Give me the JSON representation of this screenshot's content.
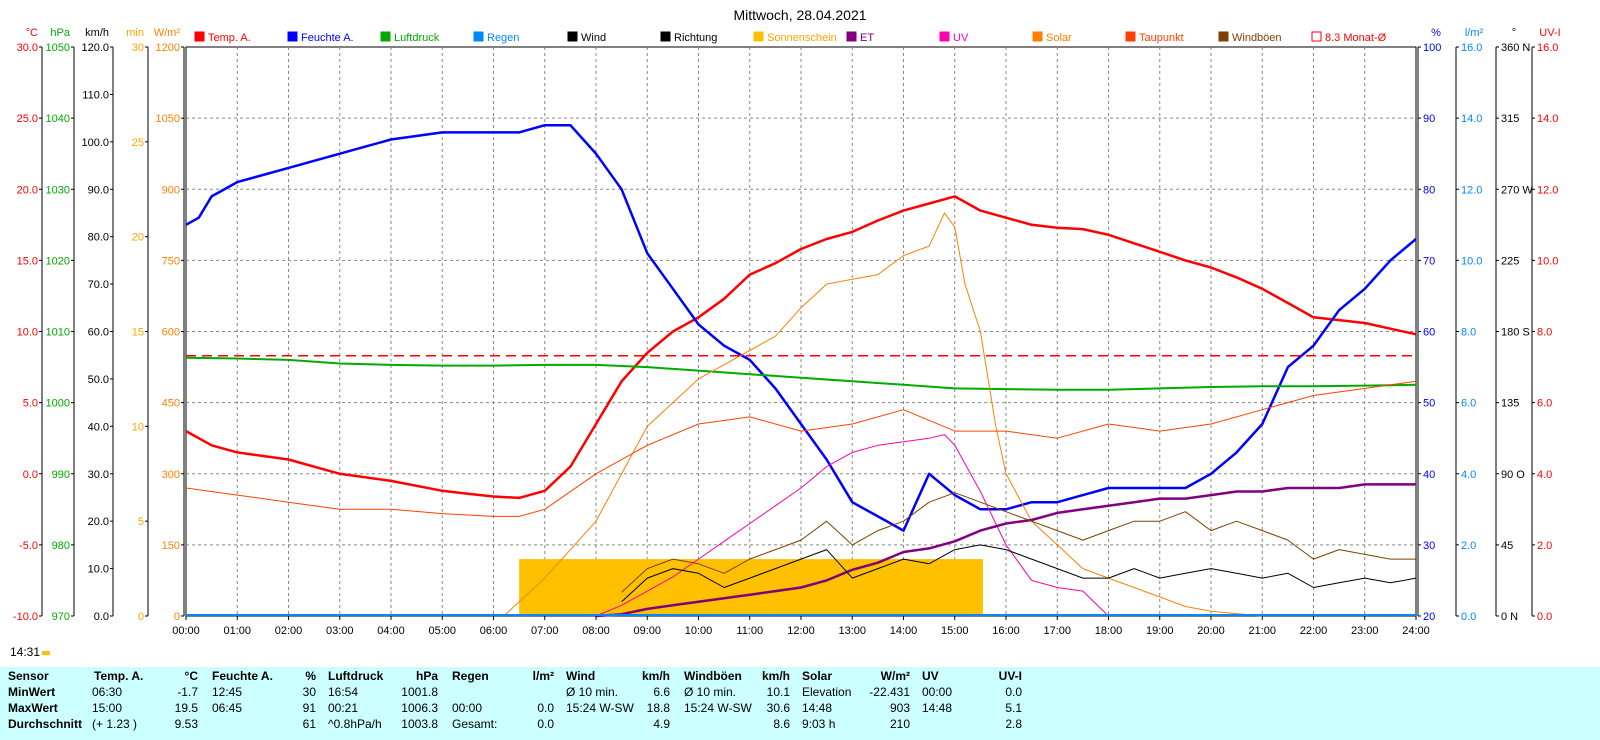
{
  "title": "Mittwoch, 28.04.2021",
  "timestamp": "14:31",
  "colors": {
    "temp": "#ff0000",
    "humidity": "#0000ff",
    "pressure": "#00aa00",
    "rain": "#0088ff",
    "wind": "#000000",
    "direction": "#000000",
    "sunshine": "#ffc000",
    "et": "#800080",
    "uv": "#ff00aa",
    "solar": "#ff8000",
    "dewpoint": "#ff4000",
    "gusts": "#804000",
    "avg": "#ff0000",
    "panel": "#ccffff"
  },
  "legend": [
    {
      "label": "Temp. A.",
      "color": "#ff0000",
      "marker": "fill"
    },
    {
      "label": "Feuchte A.",
      "color": "#0000ff",
      "marker": "fill"
    },
    {
      "label": "Luftdruck",
      "color": "#00aa00",
      "marker": "fill"
    },
    {
      "label": "Regen",
      "color": "#0088ff",
      "marker": "fill"
    },
    {
      "label": "Wind",
      "color": "#000000",
      "marker": "fill"
    },
    {
      "label": "Richtung",
      "color": "#000000",
      "marker": "fill"
    },
    {
      "label": "Sonnenschein",
      "color": "#ffc000",
      "marker": "fill"
    },
    {
      "label": "ET",
      "color": "#800080",
      "marker": "fill"
    },
    {
      "label": "UV",
      "color": "#ff00aa",
      "marker": "fill"
    },
    {
      "label": "Solar",
      "color": "#ff8000",
      "marker": "fill"
    },
    {
      "label": "Taupunkt",
      "color": "#ff4000",
      "marker": "fill"
    },
    {
      "label": "Windböen",
      "color": "#804000",
      "marker": "fill"
    },
    {
      "label": "8.3 Monat-Ø",
      "color": "#ff0000",
      "marker": "open"
    }
  ],
  "axes_left": [
    {
      "unit": "°C",
      "color": "#ff0000",
      "ticks": [
        "30.0",
        "25.0",
        "20.0",
        "15.0",
        "10.0",
        "5.0",
        "0.0",
        "-5.0",
        "-10.0"
      ]
    },
    {
      "unit": "hPa",
      "color": "#00aa00",
      "ticks": [
        "1050",
        "1040",
        "1030",
        "1020",
        "1010",
        "1000",
        "990",
        "980",
        "970"
      ]
    },
    {
      "unit": "km/h",
      "color": "#000000",
      "ticks": [
        "120.0",
        "110.0",
        "100.0",
        "90.0",
        "80.0",
        "70.0",
        "60.0",
        "50.0",
        "40.0",
        "30.0",
        "20.0",
        "10.0",
        "0.0"
      ]
    },
    {
      "unit": "min",
      "color": "#ffa500",
      "ticks": [
        "30",
        "25",
        "20",
        "15",
        "10",
        "5",
        "0"
      ]
    },
    {
      "unit": "W/m²",
      "color": "#ff8000",
      "ticks": [
        "1200",
        "1050",
        "900",
        "750",
        "600",
        "450",
        "300",
        "150",
        "0"
      ]
    }
  ],
  "axes_right": [
    {
      "unit": "%",
      "color": "#0000ff",
      "ticks": [
        "100",
        "90",
        "80",
        "70",
        "60",
        "50",
        "40",
        "30",
        "20"
      ]
    },
    {
      "unit": "l/m²",
      "color": "#0088ff",
      "ticks": [
        "16.0",
        "14.0",
        "12.0",
        "10.0",
        "8.0",
        "6.0",
        "4.0",
        "2.0",
        "0.0"
      ]
    },
    {
      "unit": "°",
      "color": "#000000",
      "ticks": [
        "360 N",
        "315",
        "270 W",
        "225",
        "180 S",
        "135",
        "90 O",
        "45",
        "0 N"
      ]
    },
    {
      "unit": "UV-I",
      "color": "#ff0000",
      "ticks": [
        "16.0",
        "14.0",
        "12.0",
        "10.0",
        "8.0",
        "6.0",
        "4.0",
        "2.0",
        "0.0"
      ]
    }
  ],
  "x_ticks": [
    "00:00",
    "01:00",
    "02:00",
    "03:00",
    "04:00",
    "05:00",
    "06:00",
    "07:00",
    "08:00",
    "09:00",
    "10:00",
    "11:00",
    "12:00",
    "13:00",
    "14:00",
    "15:00",
    "16:00",
    "17:00",
    "18:00",
    "19:00",
    "20:00",
    "21:00",
    "22:00",
    "23:00",
    "24:00"
  ],
  "chart_data": {
    "type": "line",
    "title": "Mittwoch, 28.04.2021",
    "x_unit": "hours",
    "xlim": [
      0,
      24
    ],
    "series": [
      {
        "name": "Temp. A.",
        "unit": "°C",
        "ylim": [
          -10,
          30
        ],
        "color": "#ff0000",
        "x": [
          0,
          0.5,
          1,
          2,
          3,
          4,
          5,
          5.5,
          6,
          6.5,
          7,
          7.5,
          8,
          8.5,
          9,
          9.5,
          10,
          10.5,
          11,
          11.5,
          12,
          12.5,
          13,
          13.5,
          14,
          14.5,
          15,
          15.5,
          16,
          16.5,
          17,
          17.5,
          18,
          18.5,
          19,
          19.5,
          20,
          20.5,
          21,
          21.5,
          22,
          22.5,
          23,
          23.5,
          24
        ],
        "y": [
          3.0,
          2.0,
          1.5,
          1.0,
          0.0,
          -0.5,
          -1.2,
          -1.4,
          -1.6,
          -1.7,
          -1.2,
          0.5,
          3.5,
          6.5,
          8.5,
          10,
          11,
          12.3,
          14,
          14.8,
          15.8,
          16.5,
          17,
          17.8,
          18.5,
          19,
          19.5,
          18.5,
          18,
          17.5,
          17.3,
          17.2,
          16.8,
          16.2,
          15.6,
          15,
          14.5,
          13.8,
          13,
          12,
          11,
          10.8,
          10.6,
          10.2,
          9.8
        ]
      },
      {
        "name": "Feuchte A.",
        "unit": "%",
        "ylim": [
          20,
          100
        ],
        "color": "#0000ff",
        "x": [
          0,
          0.25,
          0.5,
          1,
          1.5,
          2,
          3,
          3.5,
          4,
          5,
          6,
          6.5,
          7,
          7.5,
          8,
          8.5,
          9,
          9.5,
          10,
          10.5,
          11,
          11.5,
          12,
          12.5,
          13,
          13.5,
          14,
          14.5,
          15,
          15.5,
          16,
          16.5,
          17,
          17.5,
          18,
          18.5,
          19,
          19.5,
          20,
          20.5,
          21,
          21.5,
          22,
          22.5,
          23,
          23.5,
          24
        ],
        "y": [
          75,
          76,
          79,
          81,
          82,
          83,
          85,
          86,
          87,
          88,
          88,
          88,
          89,
          89,
          85,
          80,
          71,
          66,
          61,
          58,
          56,
          52,
          47,
          42,
          36,
          34,
          32,
          40,
          37,
          35,
          35,
          36,
          36,
          37,
          38,
          38,
          38,
          38,
          40,
          43,
          47,
          55,
          58,
          63,
          66,
          70,
          73
        ]
      },
      {
        "name": "Luftdruck",
        "unit": "hPa",
        "ylim": [
          970,
          1050
        ],
        "color": "#00aa00",
        "x": [
          0,
          1,
          2,
          3,
          4,
          5,
          6,
          7,
          8,
          9,
          10,
          11,
          12,
          13,
          14,
          15,
          16,
          17,
          18,
          19,
          20,
          21,
          22,
          23,
          24
        ],
        "y": [
          1006.3,
          1006.2,
          1006.0,
          1005.5,
          1005.3,
          1005.2,
          1005.2,
          1005.3,
          1005.3,
          1005.0,
          1004.5,
          1004.0,
          1003.5,
          1003.0,
          1002.5,
          1002.0,
          1001.9,
          1001.8,
          1001.8,
          1002.0,
          1002.2,
          1002.3,
          1002.3,
          1002.4,
          1002.5
        ]
      },
      {
        "name": "Solar",
        "unit": "W/m²",
        "ylim": [
          0,
          1200
        ],
        "color": "#ff8000",
        "x": [
          6.2,
          7,
          8,
          8.5,
          9,
          9.5,
          10,
          10.5,
          11,
          11.5,
          12,
          12.5,
          13,
          13.5,
          14,
          14.5,
          14.8,
          15,
          15.2,
          15.5,
          15.8,
          16,
          16.5,
          17,
          17.5,
          18,
          18.5,
          19,
          19.5,
          20,
          20.5,
          21
        ],
        "y": [
          0,
          80,
          200,
          300,
          400,
          450,
          500,
          530,
          560,
          590,
          650,
          700,
          710,
          720,
          760,
          780,
          850,
          820,
          700,
          600,
          400,
          300,
          200,
          150,
          100,
          80,
          60,
          40,
          20,
          10,
          5,
          0
        ]
      },
      {
        "name": "Taupunkt",
        "unit": "°C",
        "ylim": [
          -10,
          30
        ],
        "color": "#ff4000",
        "x": [
          0,
          1,
          2,
          3,
          4,
          5,
          6,
          6.5,
          7,
          8,
          9,
          10,
          11,
          12,
          13,
          14,
          15,
          16,
          17,
          18,
          19,
          20,
          21,
          22,
          23,
          24
        ],
        "y": [
          -1.0,
          -1.5,
          -2.0,
          -2.5,
          -2.5,
          -2.8,
          -3.0,
          -3.0,
          -2.5,
          0,
          2.0,
          3.5,
          4.0,
          3.0,
          3.5,
          4.5,
          3.0,
          3.0,
          2.5,
          3.5,
          3.0,
          3.5,
          4.5,
          5.5,
          6.0,
          6.5
        ]
      },
      {
        "name": "UV",
        "unit": "UV-I",
        "ylim": [
          0,
          16
        ],
        "color": "#ff00aa",
        "x": [
          8,
          8.5,
          9,
          9.5,
          10,
          10.5,
          11,
          11.5,
          12,
          12.5,
          13,
          13.5,
          14,
          14.5,
          14.8,
          15,
          15.5,
          16,
          16.5,
          17,
          17.5,
          18
        ],
        "y": [
          0,
          0.3,
          0.7,
          1.1,
          1.6,
          2.1,
          2.6,
          3.1,
          3.6,
          4.2,
          4.6,
          4.8,
          4.9,
          5.0,
          5.1,
          4.8,
          3.5,
          2.0,
          1.0,
          0.8,
          0.7,
          0.0
        ]
      },
      {
        "name": "ET",
        "unit": "l/m²",
        "ylim": [
          0,
          16
        ],
        "color": "#800080",
        "x": [
          8,
          8.5,
          9,
          9.5,
          10,
          10.5,
          11,
          11.5,
          12,
          12.5,
          13,
          13.5,
          14,
          14.5,
          15,
          15.5,
          16,
          16.5,
          17,
          17.5,
          18,
          18.5,
          19,
          19.5,
          20,
          20.5,
          21,
          21.5,
          22,
          22.5,
          23,
          23.5,
          24
        ],
        "y": [
          0,
          0.05,
          0.2,
          0.3,
          0.4,
          0.5,
          0.6,
          0.7,
          0.8,
          1.0,
          1.3,
          1.5,
          1.8,
          1.9,
          2.1,
          2.4,
          2.6,
          2.7,
          2.9,
          3.0,
          3.1,
          3.2,
          3.3,
          3.3,
          3.4,
          3.5,
          3.5,
          3.6,
          3.6,
          3.6,
          3.7,
          3.7,
          3.7
        ]
      },
      {
        "name": "Wind",
        "unit": "km/h",
        "ylim": [
          0,
          120
        ],
        "color": "#000000",
        "x": [
          8.5,
          9,
          9.5,
          10,
          10.5,
          11,
          11.5,
          12,
          12.5,
          13,
          13.5,
          14,
          14.5,
          15,
          15.5,
          16,
          16.5,
          17,
          17.5,
          18,
          18.5,
          19,
          19.5,
          20,
          20.5,
          21,
          21.5,
          22,
          22.5,
          23,
          23.5,
          24
        ],
        "y": [
          3,
          8,
          10,
          9,
          6,
          8,
          10,
          12,
          14,
          8,
          10,
          12,
          11,
          14,
          15,
          14,
          12,
          10,
          8,
          8,
          10,
          8,
          9,
          10,
          9,
          8,
          9,
          6,
          7,
          8,
          7,
          8
        ]
      },
      {
        "name": "Windböen",
        "unit": "km/h",
        "ylim": [
          0,
          120
        ],
        "color": "#804000",
        "x": [
          8.5,
          9,
          9.5,
          10,
          10.5,
          11,
          11.5,
          12,
          12.5,
          13,
          13.5,
          14,
          14.5,
          15,
          15.5,
          16,
          16.5,
          17,
          17.5,
          18,
          18.5,
          19,
          19.5,
          20,
          20.5,
          21,
          21.5,
          22,
          22.5,
          23,
          23.5,
          24
        ],
        "y": [
          5,
          10,
          12,
          11,
          9,
          12,
          14,
          16,
          20,
          15,
          18,
          20,
          24,
          26,
          24,
          22,
          20,
          18,
          16,
          18,
          20,
          20,
          22,
          18,
          20,
          18,
          16,
          12,
          14,
          13,
          12,
          12
        ]
      },
      {
        "name": "8.3 Monat-Ø",
        "unit": "°C",
        "ylim": [
          -10,
          30
        ],
        "color": "#ff0000",
        "x": [
          0,
          24
        ],
        "y": [
          8.3,
          8.3
        ]
      }
    ],
    "sunshine": {
      "name": "Sonnenschein",
      "unit": "min",
      "ylim": [
        0,
        30
      ],
      "from": 6.5,
      "to": 15.55,
      "value": 3
    },
    "rain": {
      "name": "Regen",
      "unit": "l/m²",
      "total": 0.0
    }
  },
  "stats": {
    "headers": [
      {
        "label": "Sensor",
        "unit": ""
      },
      {
        "label": "Temp. A.",
        "unit": "°C"
      },
      {
        "label": "Feuchte A.",
        "unit": "%"
      },
      {
        "label": "Luftdruck",
        "unit": "hPa"
      },
      {
        "label": "Regen",
        "unit": "l/m²"
      },
      {
        "label": "Wind",
        "unit": "km/h"
      },
      {
        "label": "Windböen",
        "unit": "km/h"
      },
      {
        "label": "Solar",
        "unit": "W/m²"
      },
      {
        "label": "UV",
        "unit": "UV-I"
      }
    ],
    "row_labels": [
      "MinWert",
      "MaxWert",
      "Durchschnitt"
    ],
    "temp": [
      [
        "06:30",
        "-1.7"
      ],
      [
        "15:00",
        "19.5"
      ],
      [
        "(+ 1.23 )",
        "9.53"
      ]
    ],
    "humidity": [
      [
        "12:45",
        "30"
      ],
      [
        "06:45",
        "91"
      ],
      [
        "",
        "61"
      ]
    ],
    "pressure": [
      [
        "16:54",
        "1001.8"
      ],
      [
        "00:21",
        "1006.3"
      ],
      [
        "^0.8hPa/h",
        "1003.8"
      ]
    ],
    "rain": [
      [
        "",
        ""
      ],
      [
        "00:00",
        "0.0"
      ],
      [
        "Gesamt:",
        "0.0"
      ]
    ],
    "wind": [
      [
        "Ø 10 min.",
        "6.6"
      ],
      [
        "15:24  W-SW",
        "18.8"
      ],
      [
        "",
        "4.9"
      ]
    ],
    "gusts": [
      [
        "Ø 10 min.",
        "10.1"
      ],
      [
        "15:24  W-SW",
        "30.6"
      ],
      [
        "",
        "8.6"
      ]
    ],
    "solar": [
      [
        "Elevation",
        "-22.431"
      ],
      [
        "14:48",
        "903"
      ],
      [
        "9:03 h",
        "210"
      ]
    ],
    "uv": [
      [
        "00:00",
        "0.0"
      ],
      [
        "14:48",
        "5.1"
      ],
      [
        "",
        "2.8"
      ]
    ]
  }
}
